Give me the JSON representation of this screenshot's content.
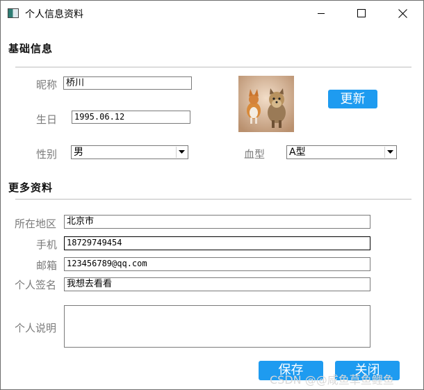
{
  "window": {
    "title": "个人信息资料"
  },
  "sections": {
    "basic": "基础信息",
    "more": "更多资料"
  },
  "basic": {
    "nickname": {
      "label": "昵称",
      "value": "桥川"
    },
    "birthday": {
      "label": "生日",
      "value": "1995.06.12"
    },
    "gender": {
      "label": "性别",
      "value": "男"
    },
    "blood": {
      "label": "血型",
      "value": "A型"
    },
    "update_label": "更新",
    "photo_icon": "dog-photo"
  },
  "more": {
    "region": {
      "label": "所在地区",
      "value": "北京市"
    },
    "phone": {
      "label": "手机",
      "value": "18729749454"
    },
    "email": {
      "label": "邮箱",
      "value": "123456789@qq.com"
    },
    "signature": {
      "label": "个人签名",
      "value": "我想去看看"
    },
    "description": {
      "label": "个人说明",
      "value": ""
    }
  },
  "actions": {
    "save_label": "保存",
    "close_label": "关闭"
  },
  "watermark": "CSDN @@咸鱼草鱼鲤鱼",
  "colors": {
    "accent": "#1e9bf0",
    "border": "#7a7a7a",
    "label": "#7a7a7a"
  }
}
